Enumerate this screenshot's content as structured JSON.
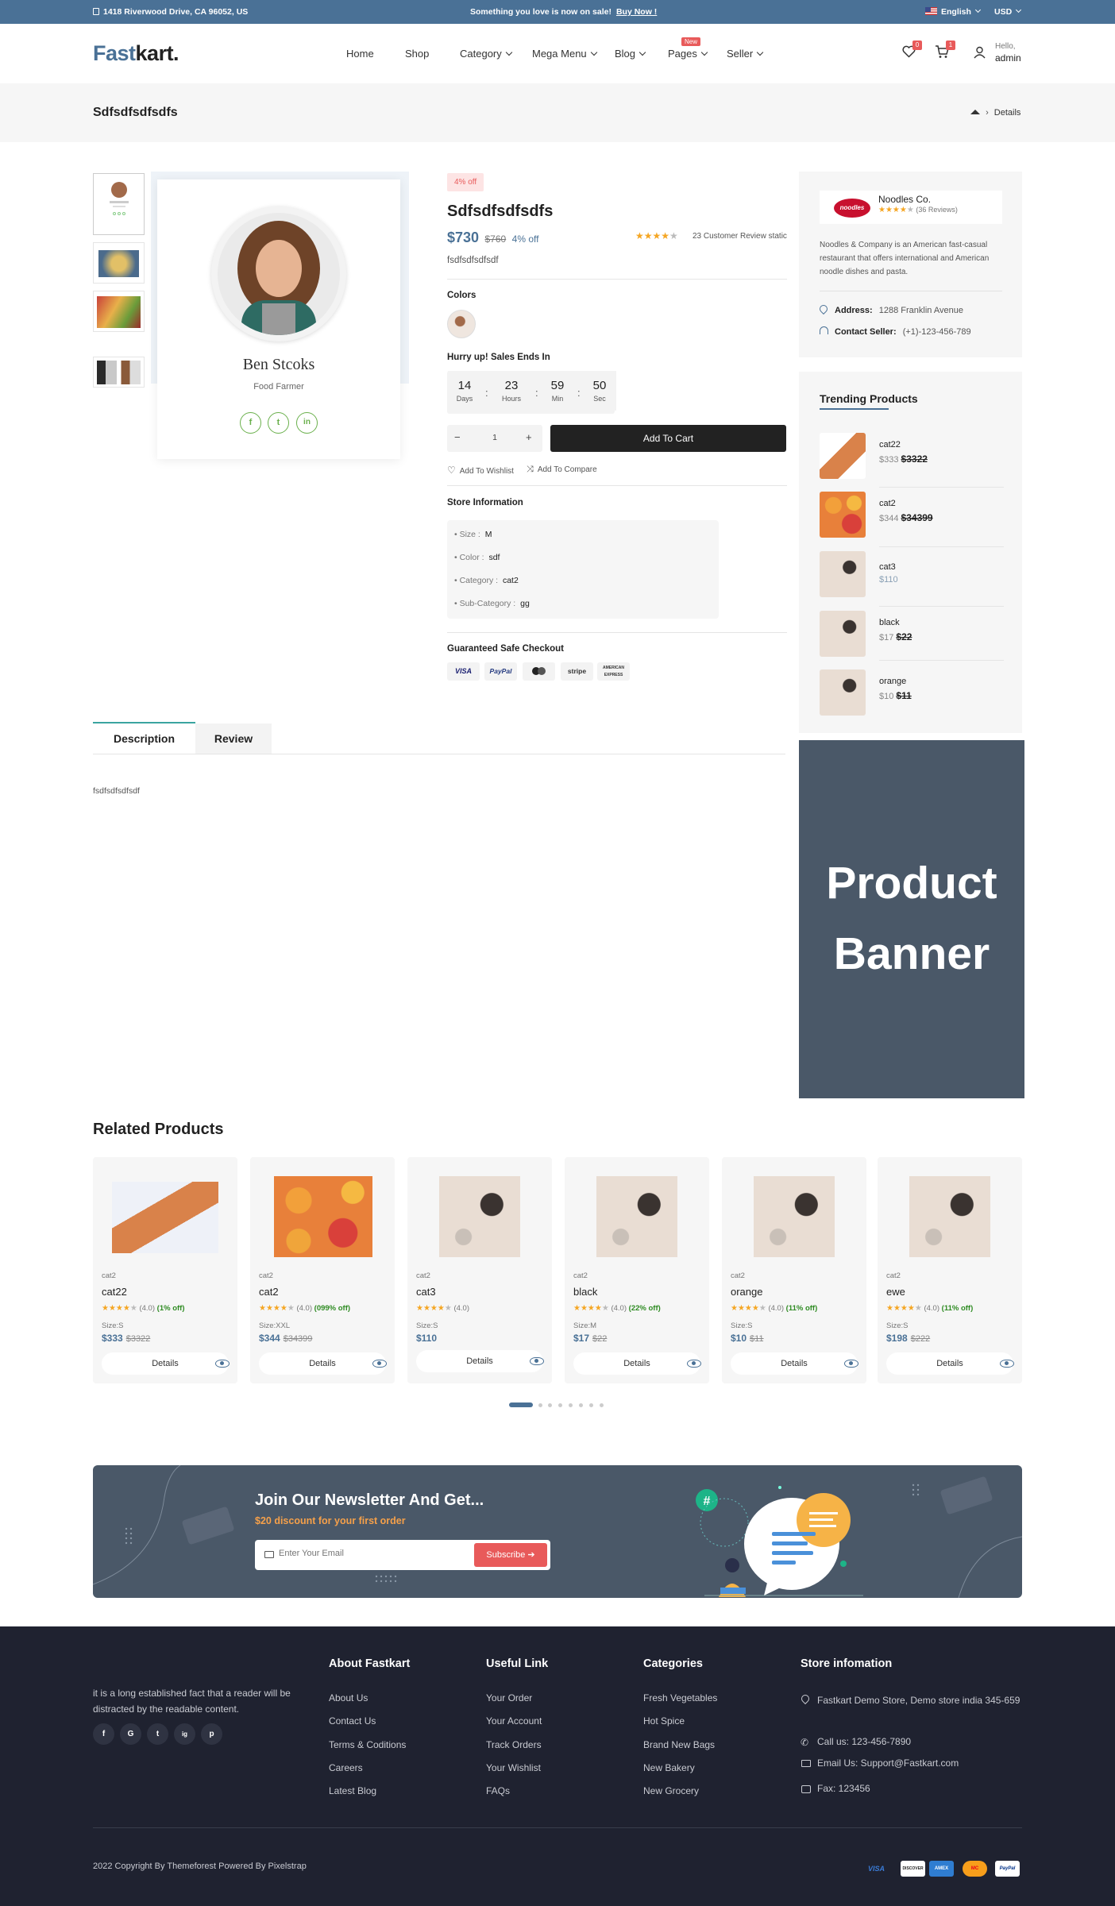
{
  "topbar": {
    "address": "1418 Riverwood Drive, CA 96052, US",
    "announcement": "Something you love is now on sale!",
    "announcement_link": "Buy Now !",
    "language": "English",
    "currency": "USD"
  },
  "header": {
    "logo_main": "Fast",
    "logo_accent": "kart.",
    "nav": [
      "Home",
      "Shop",
      "Category",
      "Mega Menu",
      "Blog",
      "Pages",
      "Seller"
    ],
    "new_tag": "New",
    "wishlist_count": "0",
    "cart_count": "1",
    "greeting": "Hello,",
    "username": "admin"
  },
  "breadcrumb": {
    "title": "Sdfsdfsdfsdfs",
    "current": "Details"
  },
  "seller_card": {
    "name": "Ben Stcoks",
    "role": "Food Farmer"
  },
  "product": {
    "discount_badge": "4% off",
    "title": "Sdfsdfsdfsdfs",
    "price": "$730",
    "old_price": "$760",
    "off_text": "4% off",
    "rating": 4,
    "reviews_text": "23 Customer Review static",
    "short_desc": "fsdfsdfsdfsdf",
    "colors_label": "Colors",
    "countdown_label": "Hurry up! Sales Ends In",
    "countdown": [
      {
        "value": "14",
        "unit": "Days"
      },
      {
        "value": "23",
        "unit": "Hours"
      },
      {
        "value": "59",
        "unit": "Min"
      },
      {
        "value": "50",
        "unit": "Sec"
      }
    ],
    "quantity": "1",
    "add_to_cart": "Add To Cart",
    "add_to_wishlist": "Add To Wishlist",
    "add_to_compare": "Add To Compare",
    "store_info_label": "Store Information",
    "store_info": [
      {
        "label": "Size :",
        "value": "M"
      },
      {
        "label": "Color :",
        "value": "sdf"
      },
      {
        "label": "Category :",
        "value": "cat2"
      },
      {
        "label": "Sub-Category :",
        "value": "gg"
      }
    ],
    "checkout_label": "Guaranteed Safe Checkout",
    "payment_methods": [
      "VISA",
      "PayPal",
      "mastercard",
      "stripe",
      "AMERICAN EXPRESS"
    ]
  },
  "vendor": {
    "logo_text": "noodles",
    "name": "Noodles Co.",
    "rating": 4,
    "reviews": "(36 Reviews)",
    "description": "Noodles & Company is an American fast-casual restaurant that offers international and American noodle dishes and pasta.",
    "address_label": "Address:",
    "address": "1288 Franklin Avenue",
    "contact_label": "Contact Seller:",
    "contact": "(+1)-123-456-789"
  },
  "trending": {
    "title": "Trending Products",
    "items": [
      {
        "name": "cat22",
        "price": "$333",
        "old": "$3322"
      },
      {
        "name": "cat2",
        "price": "$344",
        "old": "$34399"
      },
      {
        "name": "cat3",
        "price": "$110",
        "old": ""
      },
      {
        "name": "black",
        "price": "$17",
        "old": "$22"
      },
      {
        "name": "orange",
        "price": "$10",
        "old": "$11"
      }
    ]
  },
  "tabs": {
    "description": "Description",
    "review": "Review",
    "content": "fsdfsdfsdfsdf"
  },
  "banner": {
    "line1": "Product",
    "line2": "Banner"
  },
  "related": {
    "title": "Related Products",
    "items": [
      {
        "cat": "cat2",
        "name": "cat22",
        "rating": "(4.0)",
        "off": "(1% off)",
        "size": "Size:S",
        "price": "$333",
        "old": "$3322",
        "button": "Details"
      },
      {
        "cat": "cat2",
        "name": "cat2",
        "rating": "(4.0)",
        "off": "(099% off)",
        "size": "Size:XXL",
        "price": "$344",
        "old": "$34399",
        "button": "Details"
      },
      {
        "cat": "cat2",
        "name": "cat3",
        "rating": "(4.0)",
        "off": "",
        "size": "Size:S",
        "price": "$110",
        "old": "",
        "button": "Details"
      },
      {
        "cat": "cat2",
        "name": "black",
        "rating": "(4.0)",
        "off": "(22% off)",
        "size": "Size:M",
        "price": "$17",
        "old": "$22",
        "button": "Details"
      },
      {
        "cat": "cat2",
        "name": "orange",
        "rating": "(4.0)",
        "off": "(11% off)",
        "size": "Size:S",
        "price": "$10",
        "old": "$11",
        "button": "Details"
      },
      {
        "cat": "cat2",
        "name": "ewe",
        "rating": "(4.0)",
        "off": "(11% off)",
        "size": "Size:S",
        "price": "$198",
        "old": "$222",
        "button": "Details"
      }
    ]
  },
  "newsletter": {
    "title": "Join Our Newsletter And Get...",
    "subtitle": "$20 discount for your first order",
    "placeholder": "Enter Your Email",
    "button": "Subscribe"
  },
  "footer": {
    "about_text": "it is a long established fact that a reader will be distracted by the readable content.",
    "social": [
      "f",
      "G",
      "t",
      "ig",
      "p"
    ],
    "col1_title": "About Fastkart",
    "col1": [
      "About Us",
      "Contact Us",
      "Terms & Coditions",
      "Careers",
      "Latest Blog"
    ],
    "col2_title": "Useful Link",
    "col2": [
      "Your Order",
      "Your Account",
      "Track Orders",
      "Your Wishlist",
      "FAQs"
    ],
    "col3_title": "Categories",
    "col3": [
      "Fresh Vegetables",
      "Hot Spice",
      "Brand New Bags",
      "New Bakery",
      "New Grocery"
    ],
    "col4_title": "Store infomation",
    "store_address": "Fastkart Demo Store, Demo store india 345-659",
    "call": "Call us: 123-456-7890",
    "email": "Email Us: Support@Fastkart.com",
    "fax": "Fax: 123456",
    "copyright": "2022 Copyright By Themeforest Powered By Pixelstrap",
    "cards": [
      "VISA",
      "DISCOVER",
      "AMEX",
      "MC",
      "PayPal"
    ]
  },
  "colors": {
    "primary": "#4a7196",
    "topbar": "#4a7196",
    "footer": "#1f2230",
    "banner": "#4a5868",
    "accent_red": "#e85a5a",
    "green": "#2e8b22"
  }
}
